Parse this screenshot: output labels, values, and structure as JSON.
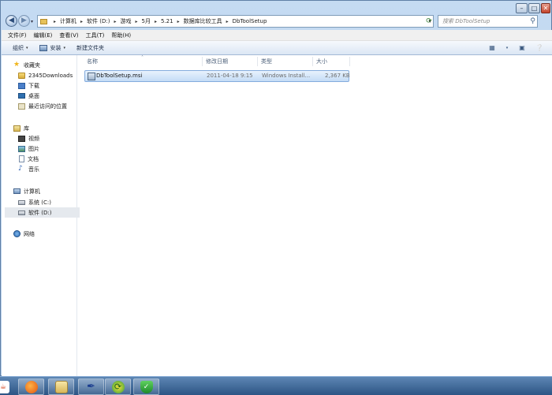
{
  "window": {
    "controls": {
      "minimize": "–",
      "maximize": "□",
      "close": "✕"
    }
  },
  "nav_buttons": {
    "back": "◀",
    "forward": "▶",
    "dropdown": "▾"
  },
  "address_bar": {
    "crumbs": [
      "计算机",
      "软件 (D:)",
      "游戏",
      "5月",
      "5.21",
      "数据库比较工具",
      "DbToolSetup"
    ],
    "separator": "▸",
    "dropdown": "▾",
    "refresh": "⟳"
  },
  "search": {
    "placeholder": "搜索 DbToolSetup",
    "icon": "search-icon"
  },
  "menu": [
    "文件(F)",
    "编辑(E)",
    "查看(V)",
    "工具(T)",
    "帮助(H)"
  ],
  "toolbar": {
    "organize": "组织",
    "install": "安装",
    "new_folder": "新建文件夹",
    "caret": "▾"
  },
  "sidebar": {
    "favorites": {
      "header": "收藏夹",
      "items": [
        "2345Downloads",
        "下载",
        "桌面",
        "最近访问的位置"
      ]
    },
    "libraries": {
      "header": "库",
      "items": [
        "视频",
        "图片",
        "文档",
        "音乐"
      ]
    },
    "computer": {
      "header": "计算机",
      "items": [
        "系统 (C:)",
        "软件 (D:)"
      ]
    },
    "network": {
      "header": "网络"
    }
  },
  "file_list": {
    "columns": [
      "名称",
      "修改日期",
      "类型",
      "大小"
    ],
    "sort_arrow": "˄",
    "rows": [
      {
        "name": "DbToolSetup.msi",
        "modified": "2011-04-18 9:15",
        "type": "Windows Install...",
        "size": "2,367 KB"
      }
    ]
  },
  "taskbar": {
    "items": [
      "java-icon",
      "firefox-icon",
      "explorer-icon",
      "pen-tool-icon",
      "refresh-app-icon",
      "shield-icon"
    ]
  }
}
